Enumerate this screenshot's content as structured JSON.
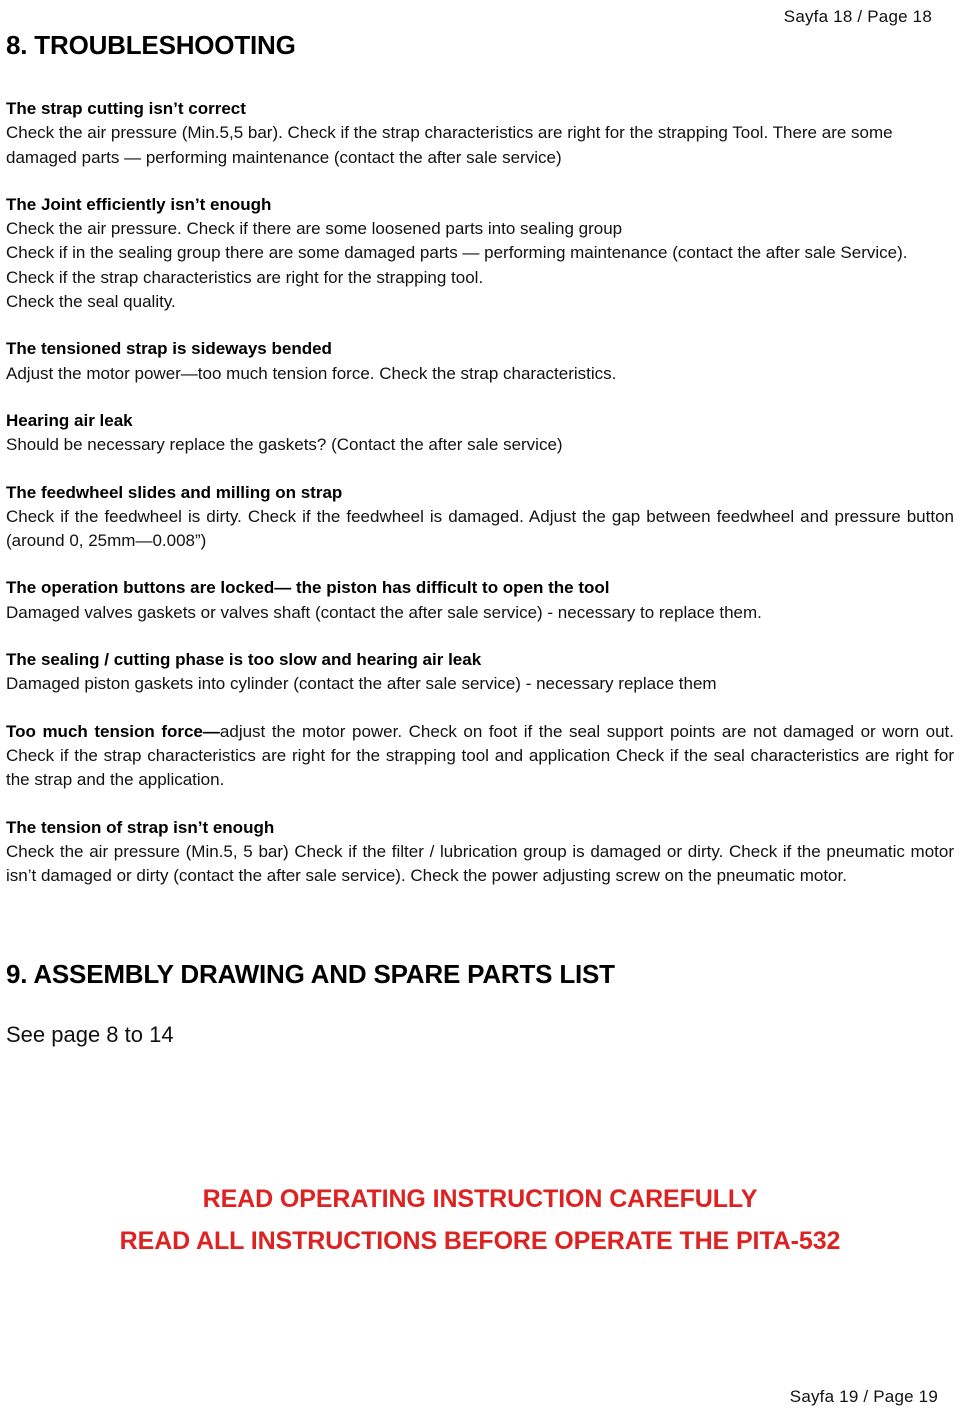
{
  "header": {
    "page_label": "Sayfa  18 / Page  18"
  },
  "footer": {
    "page_label": "Sayfa  19 / Page  19"
  },
  "sections": {
    "troubleshooting_title": "8. TROUBLESHOOTING",
    "assembly_title": "9. ASSEMBLY DRAWING AND SPARE PARTS LIST",
    "see_page": "See page 8 to 14"
  },
  "troubleshooting": [
    {
      "heading": "The strap cutting isn’t correct",
      "body": "Check the air pressure (Min.5,5 bar). Check if the strap characteristics are right for the strapping Tool. There are some damaged parts — performing maintenance (contact the after sale service)"
    },
    {
      "heading": "The Joint efficiently isn’t enough",
      "body": "Check the air pressure. Check if there are some loosened parts into sealing group",
      "body2": "Check if in the sealing group there are some damaged parts — performing maintenance (contact the after sale Service). Check if the strap characteristics are right for the strapping tool.",
      "body3": "Check the seal quality."
    },
    {
      "heading": "The tensioned strap is sideways bended",
      "body": "Adjust the motor power—too much tension force. Check the strap characteristics."
    },
    {
      "heading": "Hearing air leak",
      "body": "Should be necessary replace the gaskets? (Contact the after sale service)"
    },
    {
      "heading": "The feedwheel slides and milling on strap",
      "body": "Check if the feedwheel is dirty. Check if the feedwheel is damaged. Adjust the gap between feedwheel and pressure button (around 0, 25mm—0.008”)"
    },
    {
      "heading": "The operation buttons are locked— the piston has difficult to open the tool",
      "body": "Damaged valves gaskets or valves shaft (contact the after sale service) - necessary to replace them."
    },
    {
      "heading": "The sealing / cutting phase is too slow and hearing air leak",
      "body": "Damaged piston gaskets into cylinder (contact the after sale service) - necessary replace them"
    },
    {
      "heading": "Too much tension force—",
      "inline_heading": true,
      "body": "adjust the motor power. Check on foot if the seal support points are not damaged or worn out. Check if the strap characteristics are right for the strapping tool and application Check if the seal characteristics are right for the strap and the application."
    },
    {
      "heading": "The tension of strap isn’t enough",
      "body": "Check the air pressure (Min.5, 5 bar) Check if the filter / lubrication group is damaged or dirty. Check if the pneumatic motor isn’t damaged or dirty (contact the after sale service). Check the power adjusting screw on the pneumatic motor."
    }
  ],
  "notice": {
    "line1": "READ OPERATING INSTRUCTION CAREFULLY",
    "line2": "READ ALL INSTRUCTIONS BEFORE OPERATE THE PITA-532",
    "color": "#DD2222"
  }
}
